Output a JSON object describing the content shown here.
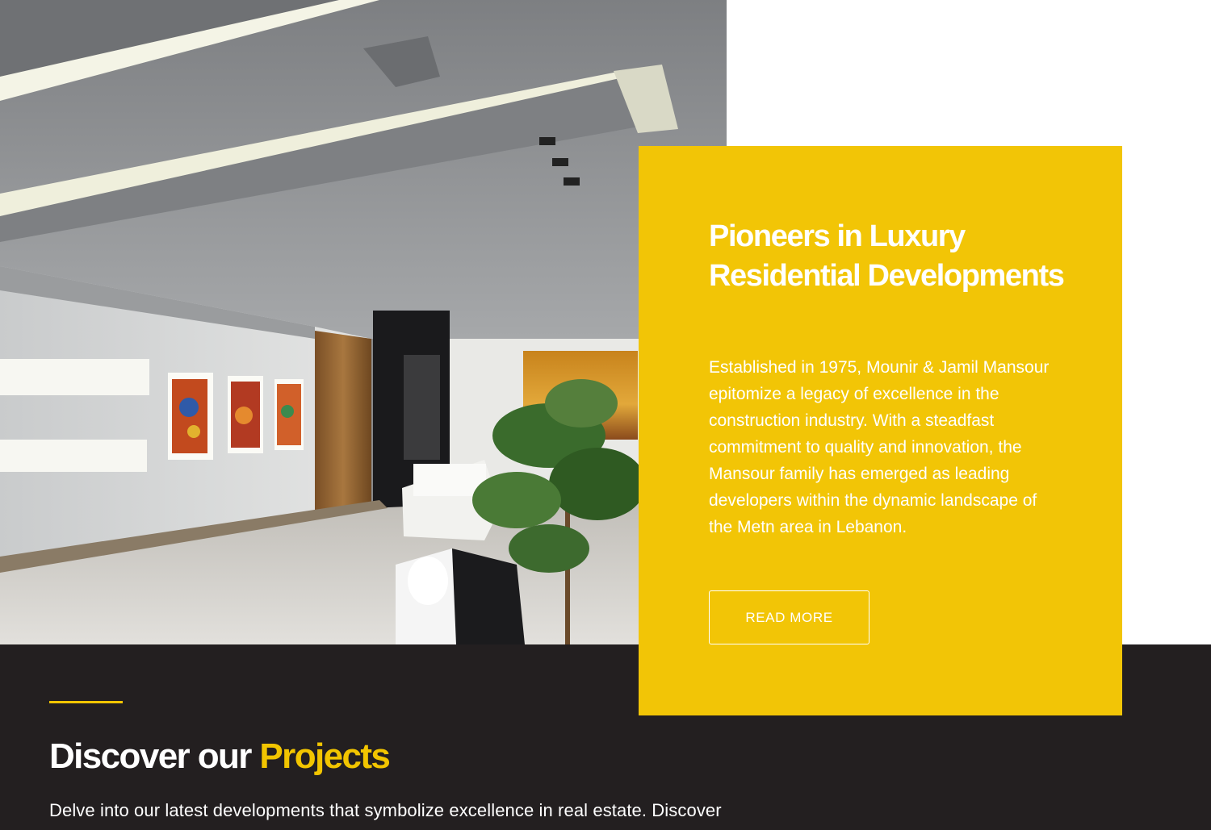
{
  "hero": {
    "image_description_icon": "interior-photo-icon"
  },
  "about_card": {
    "title": "Pioneers in Luxury Residential Developments",
    "body": "Established in 1975, Mounir & Jamil Mansour epitomize a legacy of excellence in the construction industry. With a steadfast commitment to quality and innovation, the Mansour family has emerged as leading developers within the dynamic landscape of the Metn area in Lebanon.",
    "button_label": "READ MORE"
  },
  "projects_section": {
    "title_prefix": "Discover our ",
    "title_highlight": "Projects",
    "description": "Delve into our latest developments that symbolize excellence in real estate. Discover"
  },
  "colors": {
    "accent": "#f2c500",
    "card_background": "#f2c506",
    "dark_background": "#231f20"
  }
}
